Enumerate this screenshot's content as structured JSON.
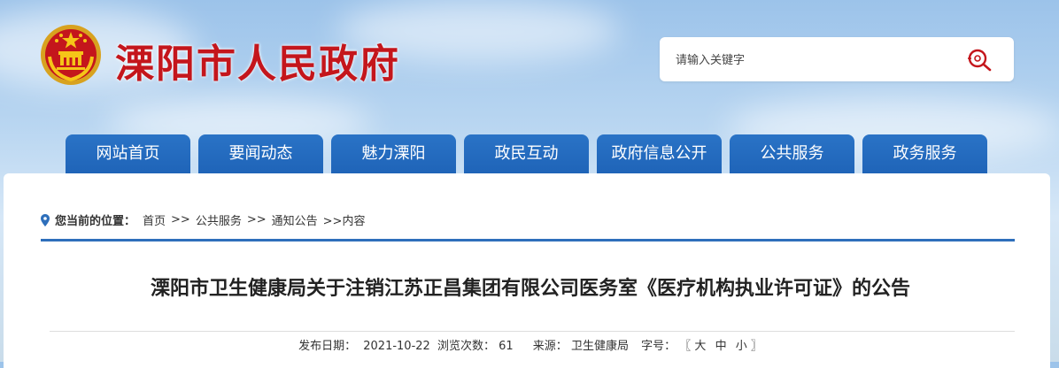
{
  "site": {
    "title": "溧阳市人民政府"
  },
  "search": {
    "placeholder": "请输入关键字"
  },
  "nav": {
    "items": [
      "网站首页",
      "要闻动态",
      "魅力溧阳",
      "政民互动",
      "政府信息公开",
      "公共服务",
      "政务服务"
    ]
  },
  "breadcrumb": {
    "label": "您当前的位置：",
    "items": [
      "首页",
      "公共服务",
      "通知公告"
    ],
    "sep": ">>",
    "current": ">>内容"
  },
  "article": {
    "title": "溧阳市卫生健康局关于注销江苏正昌集团有限公司医务室《医疗机构执业许可证》的公告",
    "publish_label": "发布日期：",
    "publish_date": "2021-10-22",
    "views_label": "浏览次数：",
    "views": "61",
    "source_label": "来源：",
    "source": "卫生健康局",
    "fontsize_label": "字号：",
    "fontsize_open": "〖",
    "fontsize_large": "大",
    "fontsize_medium": "中",
    "fontsize_small": "小",
    "fontsize_close": "〗"
  },
  "colors": {
    "title_red": "#c4161c",
    "nav_blue": "#1f64b8",
    "rule_blue": "#2e6fbb"
  },
  "icons": {
    "emblem": "national-emblem",
    "search": "search-icon",
    "location": "location-pin-icon"
  }
}
